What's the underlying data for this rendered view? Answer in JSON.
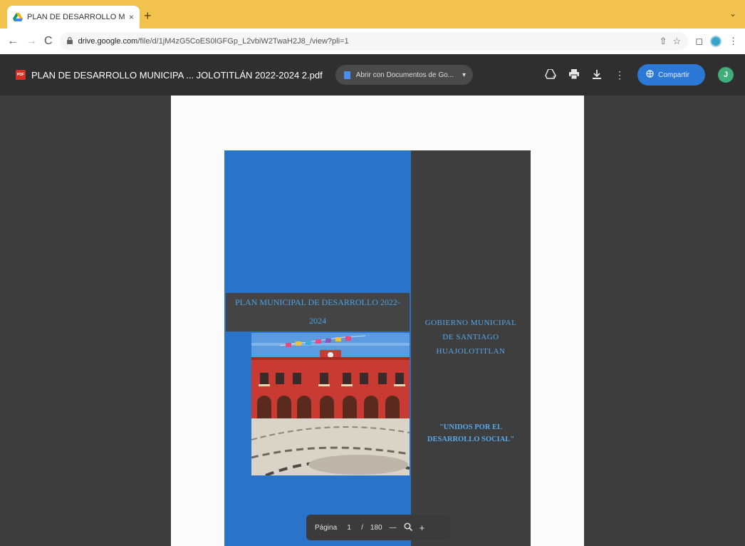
{
  "browser": {
    "tab_title": "PLAN DE DESARROLLO MUN",
    "tab_close": "×",
    "new_tab": "+",
    "tab_menu": "⌄",
    "url_host": "drive.google.com",
    "url_path": "/file/d/1jM4zG5CoES0lGFGp_L2vbiW2TwaH2J8_/view?pli=1"
  },
  "viewer": {
    "doc_title": "PLAN DE DESARROLLO MUNICIPA ... JOLOTITLÁN 2022-2024 2.pdf",
    "open_with_label": "Abrir con Documentos de Go...",
    "share_label": "Compartir",
    "avatar_initial": "J"
  },
  "cover": {
    "plan_title_line1": "PLAN MUNICIPAL DE DESARROLLO 2022-",
    "plan_title_line2": "2024",
    "gov_line1": "GOBIERNO MUNICIPAL",
    "gov_line2": "DE SANTIAGO",
    "gov_line3": "HUAJOLOTITLAN",
    "slogan_line1": "\"UNIDOS POR EL",
    "slogan_line2": "DESARROLLO SOCIAL\""
  },
  "pager": {
    "label": "Página",
    "current": "1",
    "separator": "/",
    "total": "180",
    "zoom_out": "—",
    "zoom_in": "+"
  },
  "colors": {
    "tabstrip": "#f1c34e",
    "viewer_header": "#2f2f2f",
    "share_button": "#2b78d6",
    "cover_blue": "#2a73c9",
    "cover_dark": "#3e3e3e",
    "cover_text": "#56a8ea"
  }
}
